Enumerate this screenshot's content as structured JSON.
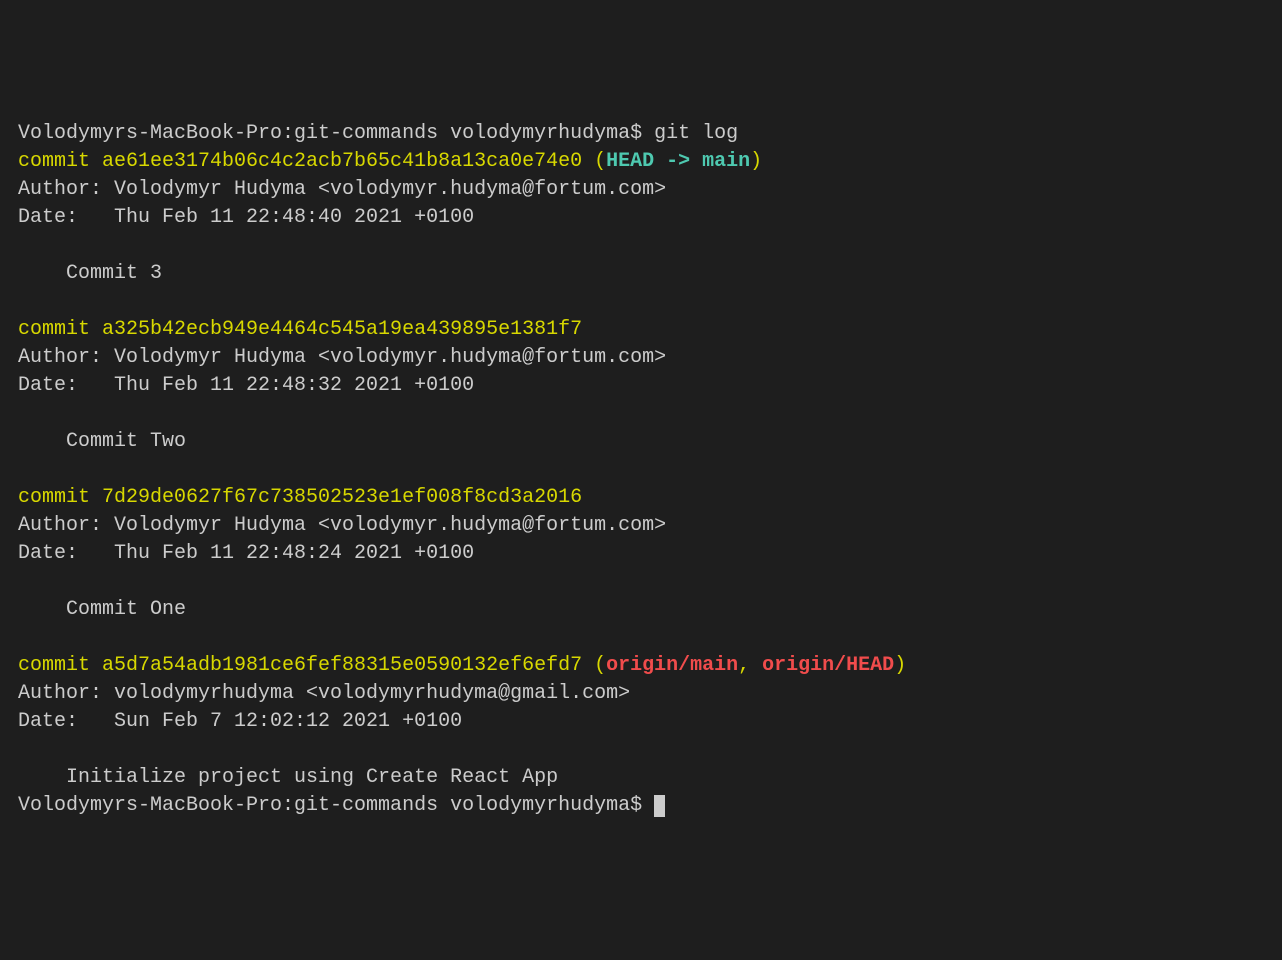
{
  "prompt": {
    "full": "Volodymyrs-MacBook-Pro:git-commands volodymyrhudyma$ "
  },
  "command": "git log",
  "commits": [
    {
      "hash_line": "commit ae61ee3174b06c4c2acb7b65c41b8a13ca0e74e0 ",
      "paren_open": "(",
      "head": "HEAD -> ",
      "branch": "main",
      "paren_close": ")",
      "author": "Author: Volodymyr Hudyma <volodymyr.hudyma@fortum.com>",
      "date": "Date:   Thu Feb 11 22:48:40 2021 +0100",
      "message": "    Commit 3"
    },
    {
      "hash_line": "commit a325b42ecb949e4464c545a19ea439895e1381f7",
      "author": "Author: Volodymyr Hudyma <volodymyr.hudyma@fortum.com>",
      "date": "Date:   Thu Feb 11 22:48:32 2021 +0100",
      "message": "    Commit Two"
    },
    {
      "hash_line": "commit 7d29de0627f67c738502523e1ef008f8cd3a2016",
      "author": "Author: Volodymyr Hudyma <volodymyr.hudyma@fortum.com>",
      "date": "Date:   Thu Feb 11 22:48:24 2021 +0100",
      "message": "    Commit One"
    },
    {
      "hash_line": "commit a5d7a54adb1981ce6fef88315e0590132ef6efd7 ",
      "paren_open": "(",
      "remote1": "origin/main",
      "sep": ", ",
      "remote2": "origin/HEAD",
      "paren_close": ")",
      "author": "Author: volodymyrhudyma <volodymyrhudyma@gmail.com>",
      "date": "Date:   Sun Feb 7 12:02:12 2021 +0100",
      "message": "    Initialize project using Create React App"
    }
  ]
}
